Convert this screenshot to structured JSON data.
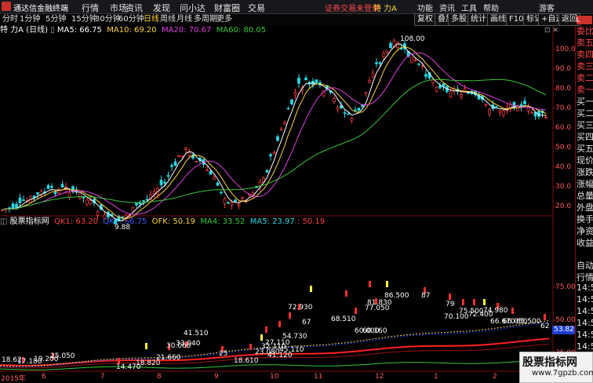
{
  "titlebar": {
    "app_name": "通达信金融终端",
    "menu": [
      "行情",
      "市场",
      "资讯",
      "发现",
      "问小达",
      "财富圈",
      "交易"
    ],
    "login_status": "证券交易未登录",
    "stock_name": "特 力A",
    "right_buttons": [
      "功能",
      "资讯",
      "工具",
      "帮助",
      "游客"
    ]
  },
  "periods": [
    "分时",
    "1分钟",
    "5分钟",
    "15分钟",
    "30分钟",
    "60分钟",
    "日线",
    "周线",
    "月线",
    "多周期",
    "更多"
  ],
  "active_period": "日线",
  "toolbar_buttons": [
    "复权",
    "叠加",
    "多股",
    "统计",
    "画线",
    "F10",
    "标记",
    "+自选",
    "返回"
  ],
  "main_header": {
    "stock": "特 力A (日线)",
    "ma5": "MA5: 66.75",
    "ma10": "MA10: 69.20",
    "ma20": "MA20: 70.67",
    "ma60": "MA60: 80.05"
  },
  "sub_header": {
    "name": "股票指标网",
    "qk1": "QK1: 63.20",
    "qk2": "QK2: 56.75",
    "ofk": "OFK: 50.19",
    "ma4": "MA4: 33.52",
    "ma5": "MA5: 23.97",
    "extra": ": 50.19"
  },
  "main_axis": [
    "100.0",
    "90.0",
    "80.0",
    "70.0",
    "60.0",
    "50.0",
    "40.0",
    "30.0",
    "20.0"
  ],
  "sub_axis": [
    "75.00",
    "50.00",
    "25.00"
  ],
  "sub_axis_current": "53.82",
  "price_high_label": "108.00",
  "price_low_label": "9.88",
  "right_panel": [
    "委比",
    "卖五",
    "卖四",
    "卖三",
    "卖二",
    "卖一",
    "买一",
    "买二",
    "买三",
    "买四",
    "买五",
    "现价",
    "涨跌",
    "涨幅",
    "总量",
    "外盘",
    "换手",
    "净资",
    "收益",
    "自动",
    "行情",
    "14:56",
    "14:56",
    "14:56",
    "14:56",
    "14:56",
    "14:56",
    "14:56",
    "14:56",
    "14:57"
  ],
  "dates": [
    "2015年",
    "6",
    "7",
    "8",
    "9",
    "10",
    "11",
    "12",
    "1",
    "2"
  ],
  "sub_labels": [
    "18.62",
    "17.180",
    "19.200",
    "25.050",
    "18.820",
    "14.470",
    "21.660",
    "30.060",
    "33.040",
    "41.510",
    "25",
    "18.610",
    "23.080",
    "27.110",
    "32.110",
    "45.110",
    "54.730",
    "41.120",
    "67",
    "72.930",
    "68.510",
    "81.830",
    "77.050",
    "86.500",
    "60.000",
    "60.160",
    "87",
    "79",
    "70.100",
    "75.500",
    "72.400",
    "74.980",
    "66.670",
    "66.050",
    "65.500",
    "62"
  ],
  "watermark": {
    "line1": "股票指标网",
    "line2": "www.7gpzb.com"
  },
  "colors": {
    "up": "#ff3b3b",
    "down": "#27d9e6",
    "ma5": "#ffffff",
    "ma10": "#ffd23c",
    "ma20": "#e040e0",
    "ma60": "#38c838"
  }
}
